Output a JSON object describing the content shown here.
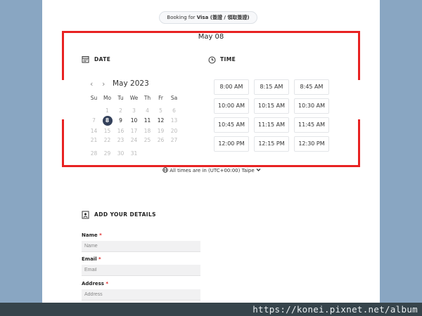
{
  "booking_pill": {
    "prefix": "Booking for ",
    "service": "Visa (簽證 / 領取簽證)"
  },
  "selected_date_title": "May 08",
  "date_section": {
    "title": "DATE",
    "month_label": "May 2023",
    "prev_icon": "chevron-left-icon",
    "next_icon": "chevron-right-icon"
  },
  "time_section": {
    "title": "TIME"
  },
  "weekdays": [
    "Su",
    "Mo",
    "Tu",
    "We",
    "Th",
    "Fr",
    "Sa"
  ],
  "calendar_weeks": [
    [
      null,
      "1",
      "2",
      "3",
      "4",
      "5",
      "6"
    ],
    [
      "7",
      "8",
      "9",
      "10",
      "11",
      "12",
      "13"
    ],
    [
      "14",
      "15",
      "16",
      "17",
      "18",
      "19",
      "20"
    ],
    [
      "21",
      "22",
      "23",
      "24",
      "25",
      "26",
      "27"
    ],
    [
      "28",
      "29",
      "30",
      "31",
      null,
      null,
      null
    ]
  ],
  "available_days": [
    "9",
    "10",
    "11",
    "12"
  ],
  "selected_day": "8",
  "time_slots": [
    "8:00 AM",
    "8:15 AM",
    "8:45 AM",
    "10:00 AM",
    "10:15 AM",
    "10:30 AM",
    "10:45 AM",
    "11:15 AM",
    "11:45 AM",
    "12:00 PM",
    "12:15 PM",
    "12:30 PM"
  ],
  "timezone": {
    "text": "All times are in  (UTC+00:00) Taipe",
    "icon": "globe-icon",
    "dropdown_icon": "chevron-down-icon"
  },
  "details": {
    "title": "ADD YOUR DETAILS",
    "icon": "contact-card-icon",
    "fields": [
      {
        "label": "Name",
        "required": "*",
        "placeholder": "Name"
      },
      {
        "label": "Email",
        "required": "*",
        "placeholder": "Email"
      },
      {
        "label": "Address",
        "required": "*",
        "placeholder": "Address"
      }
    ]
  },
  "annotation_color": "#e82222",
  "selected_color": "#34415b",
  "footer": {
    "watermark": "https://konei.pixnet.net/album"
  }
}
